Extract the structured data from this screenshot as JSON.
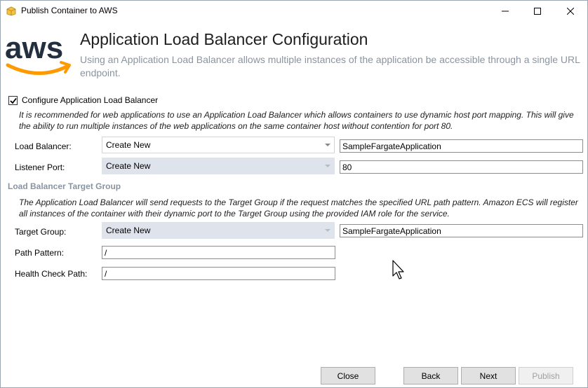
{
  "window": {
    "title": "Publish Container to AWS",
    "title_icon": "package-icon",
    "controls": [
      "minimize-icon",
      "maximize-icon",
      "close-icon"
    ]
  },
  "header": {
    "logo_text": "aws",
    "title": "Application Load Balancer Configuration",
    "description": "Using an Application Load Balancer allows multiple instances of the application be accessible through a single URL endpoint."
  },
  "alb": {
    "configure_label": "Configure Application Load Balancer",
    "configure_checked": true,
    "note": "It is recommended for web applications to use an Application Load Balancer which allows containers to use dynamic host port mapping. This will give the ability to run multiple instances of the web applications on the same container host without contention for port 80.",
    "load_balancer": {
      "label": "Load Balancer:",
      "selected": "Create New",
      "name_value": "SampleFargateApplication"
    },
    "listener_port": {
      "label": "Listener Port:",
      "selected": "Create New",
      "port_value": "80"
    }
  },
  "target_group": {
    "section_title": "Load Balancer Target Group",
    "note": "The Application Load Balancer will send requests to the Target Group if the request matches the specified URL path pattern. Amazon ECS will register all instances of the container with their dynamic port to the Target Group using the provided IAM role for the service.",
    "target": {
      "label": "Target Group:",
      "selected": "Create New",
      "name_value": "SampleFargateApplication"
    },
    "path_pattern": {
      "label": "Path Pattern:",
      "value": "/"
    },
    "health_check": {
      "label": "Health Check Path:",
      "value": "/"
    }
  },
  "buttons": {
    "close": "Close",
    "back": "Back",
    "next": "Next",
    "publish": "Publish"
  },
  "colors": {
    "aws_orange": "#f90",
    "aws_text": "#232f3e",
    "disabled_field": "#dfe3eb",
    "muted_text": "#8a94a0"
  }
}
